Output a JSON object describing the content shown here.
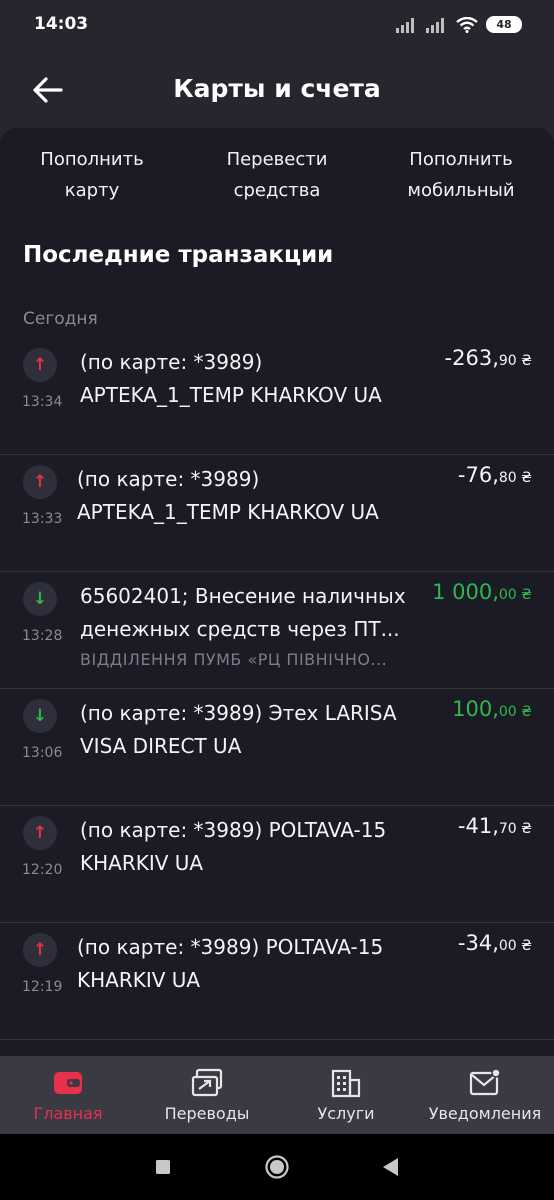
{
  "status_bar": {
    "time": "14:03",
    "battery": "48"
  },
  "header": {
    "title": "Карты и счета"
  },
  "quick_actions": [
    {
      "line1": "Пополнить",
      "line2": "карту"
    },
    {
      "line1": "Перевести",
      "line2": "средства"
    },
    {
      "line1": "Пополнить",
      "line2": "мобильный"
    }
  ],
  "section_title": "Последние транзакции",
  "day_label": "Сегодня",
  "transactions": [
    {
      "direction": "out",
      "time": "13:34",
      "description": "(по карте: *3989) APTEKA_1_TEMP KHARKOV UA",
      "amount_main": "-263,",
      "amount_cents": "90 ₴",
      "sub": ""
    },
    {
      "direction": "out",
      "time": "13:33",
      "description": "(по карте: *3989) APTEKA_1_TEMP KHARKOV UA",
      "amount_main": "-76,",
      "amount_cents": "80 ₴",
      "sub": ""
    },
    {
      "direction": "in",
      "time": "13:28",
      "description": "65602401; Внесение наличных денежных средств через  ПТ...",
      "amount_main": "1 000,",
      "amount_cents": "00 ₴",
      "sub": "ВІДДІЛЕННЯ ПУМБ «РЦ ПІВНІЧНО..."
    },
    {
      "direction": "in",
      "time": "13:06",
      "description": "(по карте: *3989) Этех LARISA VISA DIRECT UA",
      "amount_main": "100,",
      "amount_cents": "00 ₴",
      "sub": ""
    },
    {
      "direction": "out",
      "time": "12:20",
      "description": "(по карте: *3989) POLTAVA-15 KHARKIV UA",
      "amount_main": "-41,",
      "amount_cents": "70 ₴",
      "sub": ""
    },
    {
      "direction": "out",
      "time": "12:19",
      "description": "(по карте: *3989) POLTAVA-15 KHARKIV UA",
      "amount_main": "-34,",
      "amount_cents": "00 ₴",
      "sub": ""
    }
  ],
  "tabs": [
    {
      "label": "Главная",
      "icon": "wallet-icon",
      "active": true
    },
    {
      "label": "Переводы",
      "icon": "transfer-icon",
      "active": false
    },
    {
      "label": "Услуги",
      "icon": "building-icon",
      "active": false
    },
    {
      "label": "Уведомления",
      "icon": "mail-icon",
      "active": false
    }
  ],
  "colors": {
    "accent": "#e8304b",
    "positive": "#2fb84b",
    "panel": "#1b1b26",
    "header": "#26262f",
    "tabbar": "#3a3a45"
  }
}
